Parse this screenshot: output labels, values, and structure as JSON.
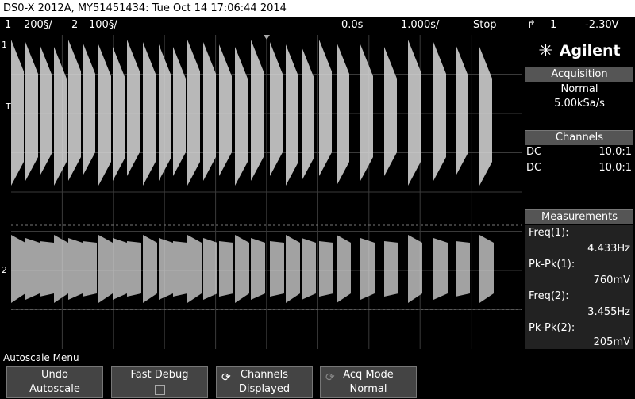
{
  "window": {
    "title": "DS0-X 2012A, MY51451434: Tue Oct 14 17:06:44 2014"
  },
  "status": {
    "ch1_num": "1",
    "ch1_scale": "200§/",
    "ch2_num": "2",
    "ch2_scale": "100§/",
    "time_pos": "0.0s",
    "time_scale": "1.000s/",
    "run_state": "Stop",
    "trig_icon": "trigger-rising-icon",
    "trig_source": "1",
    "trig_level": "-2.30V"
  },
  "markers": {
    "ch1": "1",
    "trigger": "T",
    "ch2": "2"
  },
  "panel": {
    "logo_text": "Agilent",
    "acquisition": {
      "header": "Acquisition",
      "mode": "Normal",
      "rate": "5.00kSa/s"
    },
    "channels": {
      "header": "Channels",
      "rows": [
        {
          "coupling": "DC",
          "probe": "10.0:1"
        },
        {
          "coupling": "DC",
          "probe": "10.0:1"
        }
      ]
    },
    "measurements": {
      "header": "Measurements",
      "items": [
        {
          "label": "Freq(1):",
          "value": "4.433Hz"
        },
        {
          "label": "Pk-Pk(1):",
          "value": "760mV"
        },
        {
          "label": "Freq(2):",
          "value": "3.455Hz"
        },
        {
          "label": "Pk-Pk(2):",
          "value": "205mV"
        }
      ]
    }
  },
  "menu": {
    "title": "Autoscale Menu",
    "softkeys": [
      {
        "line1": "Undo",
        "line2": "Autoscale"
      },
      {
        "line1": "Fast Debug",
        "line2": ""
      },
      {
        "line1": "Channels",
        "line2": "Displayed"
      },
      {
        "line1": "Acq Mode",
        "line2": "Normal"
      }
    ]
  },
  "colors": {
    "trace": "#d8d8d8",
    "grid": "#3a3a3a",
    "panel_header": "#555555"
  }
}
